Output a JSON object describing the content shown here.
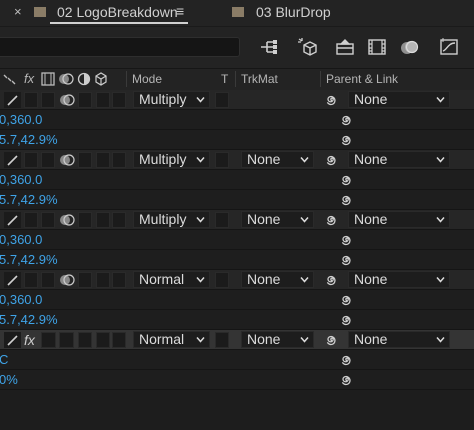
{
  "tabs": [
    {
      "close": "×",
      "label": "02 LogoBreakdown",
      "menu": "≡",
      "active": true,
      "swatch": "#8a7c66"
    },
    {
      "label": "03 BlurDrop",
      "active": false,
      "swatch": "#8a7c66"
    }
  ],
  "search": {
    "value": "",
    "placeholder": ""
  },
  "columns": {
    "fx": "fx",
    "mode": "Mode",
    "t": "T",
    "trkmat": "TrkMat",
    "parent": "Parent & Link"
  },
  "layers": [
    {
      "mode": "Multiply",
      "trkmat": "",
      "parent": "None",
      "prop1": "0,360.0",
      "prop2": "5.7,42.9%",
      "has_fx": false,
      "selected": false
    },
    {
      "mode": "Multiply",
      "trkmat": "None",
      "parent": "None",
      "prop1": "0,360.0",
      "prop2": "5.7,42.9%",
      "has_fx": false,
      "selected": false
    },
    {
      "mode": "Multiply",
      "trkmat": "None",
      "parent": "None",
      "prop1": "0,360.0",
      "prop2": "5.7,42.9%",
      "has_fx": false,
      "selected": false
    },
    {
      "mode": "Normal",
      "trkmat": "None",
      "parent": "None",
      "prop1": "0,360.0",
      "prop2": "5.7,42.9%",
      "has_fx": false,
      "selected": false
    },
    {
      "mode": "Normal",
      "trkmat": "None",
      "parent": "None",
      "prop1": "C",
      "prop2": "0%",
      "has_fx": true,
      "fx_label": "fx",
      "selected": true
    }
  ],
  "colors": {
    "accent_blue": "#3fa4e8",
    "panel": "#1d1d1d"
  }
}
